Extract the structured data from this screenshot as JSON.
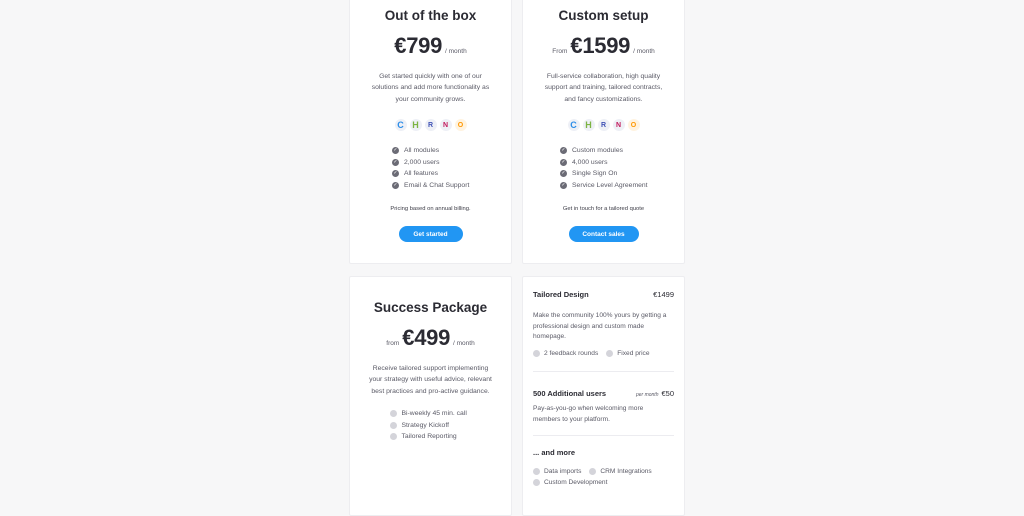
{
  "plans": [
    {
      "title": "Out of the box",
      "from": "",
      "price": "€799",
      "per": "/ month",
      "description": "Get started quickly with one of our solutions and add more functionality as your community grows.",
      "features": [
        "All modules",
        "2,000 users",
        "All features",
        "Email & Chat Support"
      ],
      "note": "Pricing based on annual billing.",
      "button": "Get started"
    },
    {
      "title": "Custom setup",
      "from": "From",
      "price": "€1599",
      "per": "/ month",
      "description": "Full-service collaboration, high quality support and training, tailored contracts, and fancy customizations.",
      "features": [
        "Custom modules",
        "4,000 users",
        "Single Sign On",
        "Service Level Agreement"
      ],
      "note": "Get in touch for a tailored quote",
      "button": "Contact sales"
    }
  ],
  "module_icons": [
    "C",
    "H",
    "R",
    "N",
    "O"
  ],
  "success": {
    "title": "Success Package",
    "from": "from",
    "price": "€499",
    "per": "/ month",
    "description": "Receive tailored support implementing your strategy with useful advice, relevant best practices and pro-active guidance.",
    "features": [
      "Bi-weekly 45 min. call",
      "Strategy Kickoff",
      "Tailored Reporting"
    ]
  },
  "addons": {
    "design": {
      "title": "Tailored Design",
      "price": "€1499",
      "description": "Make the community 100% yours by getting a professional design and custom made homepage.",
      "tags": [
        "2 feedback rounds",
        "Fixed price"
      ]
    },
    "users": {
      "title": "500 Additional users",
      "per": "per month",
      "price": "€50",
      "description": "Pay-as-you-go when welcoming more members to your platform."
    },
    "more": {
      "title": "... and more",
      "tags": [
        "Data imports",
        "CRM Integrations",
        "Custom Development"
      ]
    }
  }
}
